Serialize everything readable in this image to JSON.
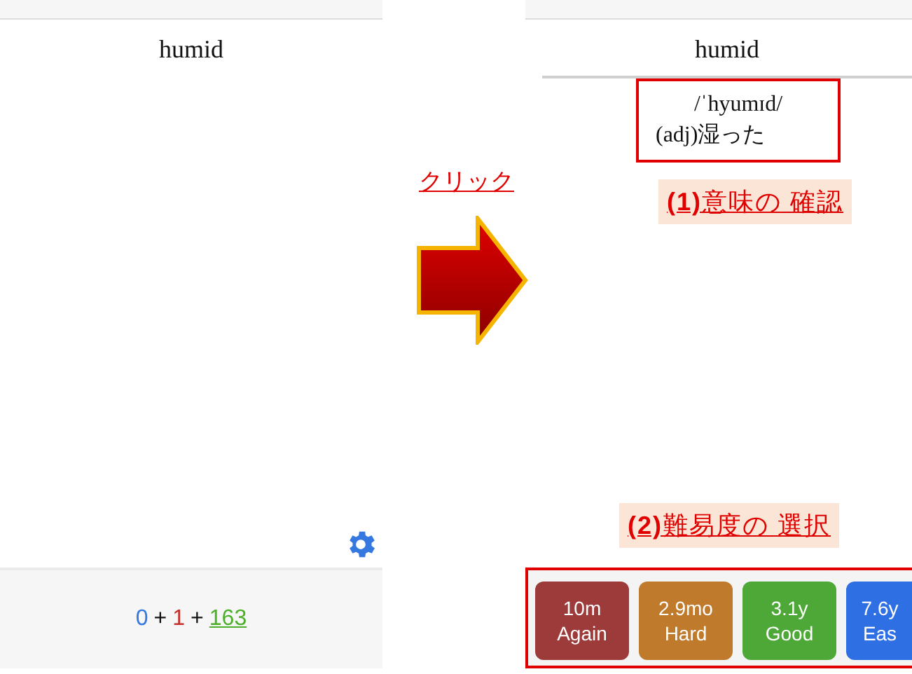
{
  "left_screen": {
    "card_front": "humid",
    "counts": [
      {
        "kind": "count",
        "text": "0",
        "color": "#3478e0",
        "underlined": false
      },
      {
        "kind": "sign",
        "text": "+"
      },
      {
        "kind": "count",
        "text": "1",
        "color": "#c9302c",
        "underlined": false
      },
      {
        "kind": "sign",
        "text": "+"
      },
      {
        "kind": "count",
        "text": "163",
        "color": "#4caf2a",
        "underlined": true
      }
    ]
  },
  "transition": {
    "label": "クリック"
  },
  "right_screen": {
    "card_front": "humid",
    "pronunciation": "/ˈhyumɪd/",
    "meaning": "(adj)湿った",
    "answer_buttons": [
      {
        "interval": "10m",
        "label": "Again",
        "color": "#9c3b3a"
      },
      {
        "interval": "2.9mo",
        "label": "Hard",
        "color": "#c07a2c"
      },
      {
        "interval": "3.1y",
        "label": "Good",
        "color": "#4ea838"
      },
      {
        "interval": "7.6y",
        "label": "Eas",
        "color": "#2f6fe4"
      }
    ]
  },
  "annotations": [
    "**(1)**意味の 確認",
    "**(2)**難易度の 選択"
  ]
}
